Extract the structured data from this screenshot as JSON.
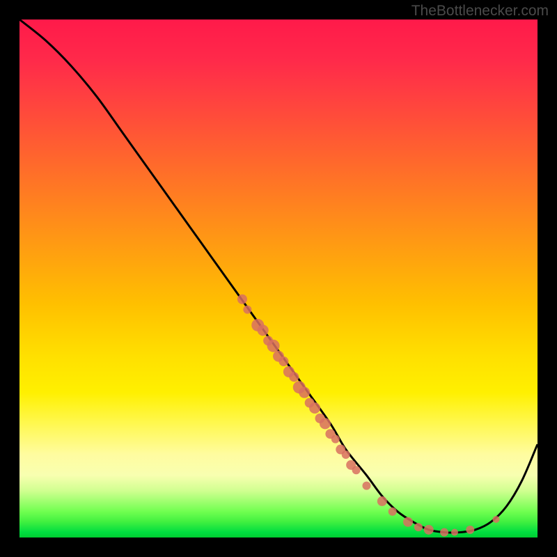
{
  "watermark": "TheBottlenecker.com",
  "chart_data": {
    "type": "line",
    "title": "",
    "xlabel": "",
    "ylabel": "",
    "xlim": [
      0,
      100
    ],
    "ylim": [
      0,
      100
    ],
    "grid": false,
    "legend": false,
    "series": [
      {
        "name": "bottleneck-curve",
        "color": "#000000",
        "x": [
          0,
          5,
          10,
          15,
          20,
          25,
          30,
          35,
          40,
          45,
          50,
          55,
          60,
          63,
          67,
          70,
          73,
          76,
          79,
          82,
          85,
          88,
          91,
          94,
          97,
          100
        ],
        "y": [
          100,
          96,
          91,
          85,
          78,
          71,
          64,
          57,
          50,
          43,
          36,
          29,
          22,
          17,
          12,
          8,
          5,
          3,
          1.5,
          1,
          1,
          1.5,
          3,
          6,
          11,
          18
        ]
      }
    ],
    "scatter_points": [
      {
        "name": "data-markers",
        "color": "#d87060",
        "points": [
          {
            "x": 43,
            "y": 46,
            "r": 7
          },
          {
            "x": 44,
            "y": 44,
            "r": 6
          },
          {
            "x": 46,
            "y": 41,
            "r": 9
          },
          {
            "x": 47,
            "y": 40,
            "r": 8
          },
          {
            "x": 48,
            "y": 38,
            "r": 7
          },
          {
            "x": 49,
            "y": 37,
            "r": 9
          },
          {
            "x": 50,
            "y": 35,
            "r": 8
          },
          {
            "x": 51,
            "y": 34,
            "r": 7
          },
          {
            "x": 52,
            "y": 32,
            "r": 8
          },
          {
            "x": 53,
            "y": 31,
            "r": 7
          },
          {
            "x": 54,
            "y": 29,
            "r": 9
          },
          {
            "x": 55,
            "y": 28,
            "r": 8
          },
          {
            "x": 56,
            "y": 26,
            "r": 7
          },
          {
            "x": 57,
            "y": 25,
            "r": 8
          },
          {
            "x": 58,
            "y": 23,
            "r": 7
          },
          {
            "x": 59,
            "y": 22,
            "r": 8
          },
          {
            "x": 60,
            "y": 20,
            "r": 7
          },
          {
            "x": 61,
            "y": 19,
            "r": 6
          },
          {
            "x": 62,
            "y": 17,
            "r": 7
          },
          {
            "x": 63,
            "y": 16,
            "r": 6
          },
          {
            "x": 64,
            "y": 14,
            "r": 7
          },
          {
            "x": 65,
            "y": 13,
            "r": 6
          },
          {
            "x": 67,
            "y": 10,
            "r": 6
          },
          {
            "x": 70,
            "y": 7,
            "r": 7
          },
          {
            "x": 72,
            "y": 5,
            "r": 6
          },
          {
            "x": 75,
            "y": 3,
            "r": 7
          },
          {
            "x": 77,
            "y": 2,
            "r": 6
          },
          {
            "x": 79,
            "y": 1.5,
            "r": 7
          },
          {
            "x": 82,
            "y": 1,
            "r": 6
          },
          {
            "x": 84,
            "y": 1,
            "r": 5
          },
          {
            "x": 87,
            "y": 1.5,
            "r": 6
          },
          {
            "x": 92,
            "y": 3.5,
            "r": 5
          }
        ]
      }
    ],
    "background_gradient": {
      "type": "vertical",
      "description": "red-yellow-green heat gradient",
      "stops": [
        {
          "pos": 0,
          "color": "#ff1a4a"
        },
        {
          "pos": 50,
          "color": "#ffc000"
        },
        {
          "pos": 90,
          "color": "#d0ff90"
        },
        {
          "pos": 100,
          "color": "#00cc30"
        }
      ]
    }
  }
}
